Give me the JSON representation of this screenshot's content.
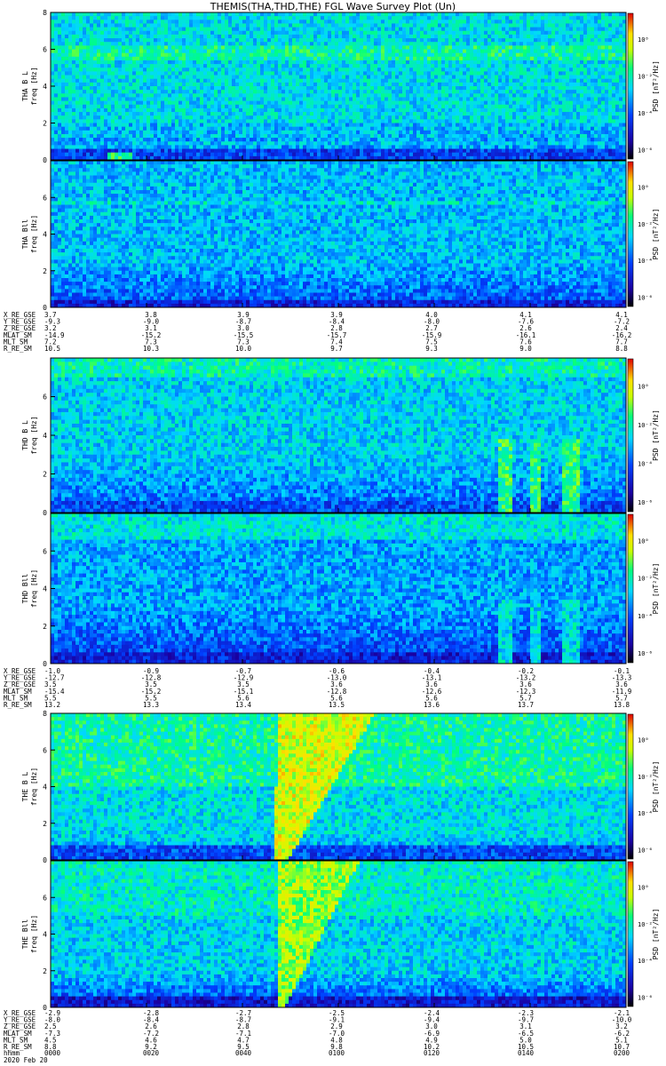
{
  "title": "THEMIS(THA,THD,THE) FGL Wave Survey Plot (Un)",
  "date": "2020 Feb 20",
  "chart_data": {
    "type": "heatmap",
    "title": "THEMIS(THA,THD,THE) FGL Wave Survey Plot (Un)",
    "time_labels": [
      "0000",
      "0020",
      "0040",
      "0100",
      "0120",
      "0140",
      "0200"
    ],
    "panels": [
      {
        "probe": "THA",
        "component": "B L",
        "ylabel_top": "THA B L",
        "ylabel": "freq [Hz]",
        "ylim": [
          0,
          8
        ],
        "yticks": [
          "0",
          "2",
          "4",
          "6",
          "8"
        ],
        "cbar_label": "PSD [nT²/Hz]",
        "cbar_ticks": [
          "10⁰",
          "10⁻²",
          "10⁻⁴",
          "10⁻⁶"
        ],
        "features": "narrowband low-frequency lines below 2 Hz, weak emission near 6 Hz"
      },
      {
        "probe": "THA",
        "component": "B ll",
        "ylabel_top": "THA Bll",
        "ylabel": "freq [Hz]",
        "ylim": [
          0,
          8
        ],
        "yticks": [
          "0",
          "2",
          "4",
          "6"
        ],
        "cbar_label": "PSD [nT²/Hz]",
        "cbar_ticks": [
          "10⁰",
          "10⁻²",
          "10⁻⁴",
          "10⁻⁶"
        ],
        "features": "broadband noise, weak line near 5.7 Hz"
      },
      {
        "probe": "THD",
        "component": "B L",
        "ylabel_top": "THD B L",
        "ylabel": "freq [Hz]",
        "ylim": [
          0,
          8
        ],
        "yticks": [
          "0",
          "2",
          "4",
          "6"
        ],
        "cbar_label": "PSD [nT²/Hz]",
        "cbar_ticks": [
          "10⁰",
          "10⁻²",
          "10⁻⁴",
          "10⁻⁶"
        ],
        "features": "bursts near 01:40-01:55 reaching 4 Hz"
      },
      {
        "probe": "THD",
        "component": "B ll",
        "ylabel_top": "THD Bll",
        "ylabel": "freq [Hz]",
        "ylim": [
          0,
          8
        ],
        "yticks": [
          "0",
          "2",
          "4",
          "6"
        ],
        "cbar_label": "PSD [nT²/Hz]",
        "cbar_ticks": [
          "10⁰",
          "10⁻²",
          "10⁻⁴",
          "10⁻⁶"
        ],
        "features": "vertical striations, bursts near 01:40-01:55"
      },
      {
        "probe": "THE",
        "component": "B L",
        "ylabel_top": "THE B L",
        "ylabel": "freq [Hz]",
        "ylim": [
          0,
          8
        ],
        "yticks": [
          "0",
          "2",
          "4",
          "6",
          "8"
        ],
        "cbar_label": "PSD [nT²/Hz]",
        "cbar_ticks": [
          "10⁰",
          "10⁻²",
          "10⁻⁴",
          "10⁻⁶"
        ],
        "features": "strong V-shaped emission centred near 00:45"
      },
      {
        "probe": "THE",
        "component": "B ll",
        "ylabel_top": "THE Bll",
        "ylabel": "freq [Hz]",
        "ylim": [
          0,
          8
        ],
        "yticks": [
          "0",
          "2",
          "4",
          "6"
        ],
        "cbar_label": "PSD [nT²/Hz]",
        "cbar_ticks": [
          "10⁰",
          "10⁻²",
          "10⁻⁴",
          "10⁻⁶"
        ],
        "features": "V-shaped emission centred near 00:45"
      }
    ],
    "ephemeris": [
      {
        "probe": "THA",
        "rows": [
          {
            "label": "X_RE_GSE",
            "values": [
              "3.7",
              "3.8",
              "3.9",
              "3.9",
              "4.0",
              "4.1",
              "4.1"
            ]
          },
          {
            "label": "Y_RE_GSE",
            "values": [
              "-9.3",
              "-9.0",
              "-8.7",
              "-8.4",
              "-8.0",
              "-7.6",
              "-7.2"
            ]
          },
          {
            "label": "Z_RE_GSE",
            "values": [
              "3.2",
              "3.1",
              "3.0",
              "2.8",
              "2.7",
              "2.6",
              "2.4"
            ]
          },
          {
            "label": "MLAT_SM",
            "values": [
              "-14.9",
              "-15.2",
              "-15.5",
              "-15.7",
              "-15.9",
              "-16.1",
              "-16.2"
            ]
          },
          {
            "label": "MLT_SM",
            "values": [
              "7.2",
              "7.3",
              "7.3",
              "7.4",
              "7.5",
              "7.6",
              "7.7"
            ]
          },
          {
            "label": "R_RE_SM",
            "values": [
              "10.5",
              "10.3",
              "10.0",
              "9.7",
              "9.3",
              "9.0",
              "8.8"
            ]
          }
        ]
      },
      {
        "probe": "THD",
        "rows": [
          {
            "label": "X_RE_GSE",
            "values": [
              "-1.0",
              "-0.9",
              "-0.7",
              "-0.6",
              "-0.4",
              "-0.2",
              "-0.1"
            ]
          },
          {
            "label": "Y_RE_GSE",
            "values": [
              "-12.7",
              "-12.8",
              "-12.9",
              "-13.0",
              "-13.1",
              "-13.2",
              "-13.3"
            ]
          },
          {
            "label": "Z_RE_GSE",
            "values": [
              "3.5",
              "3.5",
              "3.5",
              "3.6",
              "3.6",
              "3.6",
              "3.6"
            ]
          },
          {
            "label": "MLAT_SM",
            "values": [
              "-15.4",
              "-15.2",
              "-15.1",
              "-12.8",
              "-12.6",
              "-12.3",
              "-11.9"
            ]
          },
          {
            "label": "MLT_SM",
            "values": [
              "5.5",
              "5.5",
              "5.6",
              "5.6",
              "5.6",
              "5.7",
              "5.7"
            ]
          },
          {
            "label": "R_RE_SM",
            "values": [
              "13.2",
              "13.3",
              "13.4",
              "13.5",
              "13.6",
              "13.7",
              "13.8"
            ]
          }
        ]
      },
      {
        "probe": "THE",
        "rows": [
          {
            "label": "X_RE_GSE",
            "values": [
              "-2.9",
              "-2.8",
              "-2.7",
              "-2.5",
              "-2.4",
              "-2.3",
              "-2.1"
            ]
          },
          {
            "label": "Y_RE_GSE",
            "values": [
              "-8.0",
              "-8.4",
              "-8.7",
              "-9.1",
              "-9.4",
              "-9.7",
              "-10.0"
            ]
          },
          {
            "label": "Z_RE_GSE",
            "values": [
              "2.5",
              "2.6",
              "2.8",
              "2.9",
              "3.0",
              "3.1",
              "3.2"
            ]
          },
          {
            "label": "MLAT_SM",
            "values": [
              "-7.3",
              "-7.2",
              "-7.1",
              "-7.0",
              "-6.9",
              "-6.5",
              "-6.2"
            ]
          },
          {
            "label": "MLT_SM",
            "values": [
              "4.5",
              "4.6",
              "4.7",
              "4.8",
              "4.9",
              "5.0",
              "5.1"
            ]
          },
          {
            "label": "R_RE_SM",
            "values": [
              "8.8",
              "9.2",
              "9.5",
              "9.8",
              "10.2",
              "10.5",
              "10.7"
            ]
          }
        ]
      }
    ],
    "time_row_label": "hhmm",
    "colors": {
      "low": "#000080",
      "mid": "#00ffff",
      "high": "#ffff00",
      "max": "#ff0000"
    }
  }
}
